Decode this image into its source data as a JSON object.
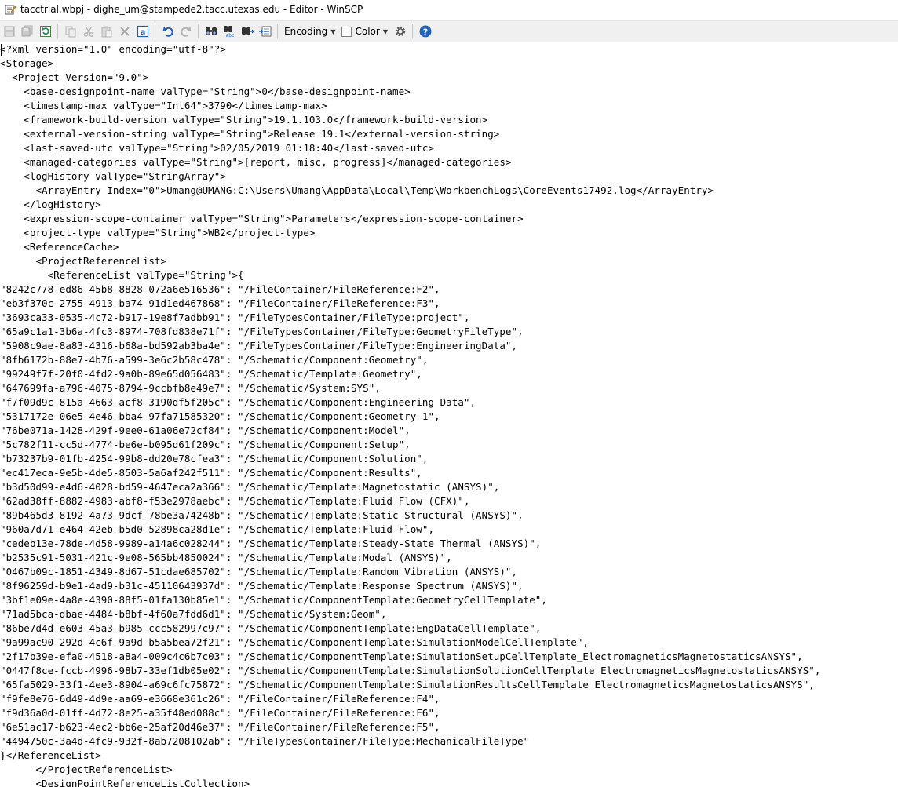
{
  "window": {
    "title": "tacctrial.wbpj - dighe_um@stampede2.tacc.utexas.edu - Editor - WinSCP"
  },
  "toolbar": {
    "buttons": [
      {
        "name": "save-icon",
        "enabled": false
      },
      {
        "name": "save-all-icon",
        "enabled": false
      },
      {
        "name": "reload-icon",
        "enabled": true
      },
      {
        "name": "copy-icon",
        "enabled": false
      },
      {
        "name": "cut-icon",
        "enabled": false
      },
      {
        "name": "paste-icon",
        "enabled": false
      },
      {
        "name": "delete-icon",
        "enabled": false
      },
      {
        "name": "select-all-icon",
        "enabled": true
      },
      {
        "name": "undo-icon",
        "enabled": true
      },
      {
        "name": "redo-icon",
        "enabled": false
      },
      {
        "name": "find-icon",
        "enabled": true
      },
      {
        "name": "replace-icon",
        "enabled": true
      },
      {
        "name": "find-next-icon",
        "enabled": true
      },
      {
        "name": "goto-line-icon",
        "enabled": true
      }
    ],
    "encoding_label": "Encoding",
    "color_label": "Color",
    "settings_icon": "gear-icon",
    "help_icon": "help-icon",
    "colors": {
      "blue": "#1f62b7",
      "green": "#2e8b57",
      "disabled": "#b4b4b4"
    }
  },
  "editor": {
    "lines": [
      "<?xml version=\"1.0\" encoding=\"utf-8\"?>",
      "<Storage>",
      "  <Project Version=\"9.0\">",
      "    <base-designpoint-name valType=\"String\">0</base-designpoint-name>",
      "    <timestamp-max valType=\"Int64\">3790</timestamp-max>",
      "    <framework-build-version valType=\"String\">19.1.103.0</framework-build-version>",
      "    <external-version-string valType=\"String\">Release 19.1</external-version-string>",
      "    <last-saved-utc valType=\"String\">02/05/2019 01:18:40</last-saved-utc>",
      "    <managed-categories valType=\"String\">[report, misc, progress]</managed-categories>",
      "    <logHistory valType=\"StringArray\">",
      "      <ArrayEntry Index=\"0\">Umang@UMANG:C:\\Users\\Umang\\AppData\\Local\\Temp\\WorkbenchLogs\\CoreEvents17492.log</ArrayEntry>",
      "    </logHistory>",
      "    <expression-scope-container valType=\"String\">Parameters</expression-scope-container>",
      "    <project-type valType=\"String\">WB2</project-type>",
      "    <ReferenceCache>",
      "      <ProjectReferenceList>",
      "        <ReferenceList valType=\"String\">{",
      "\"8242c778-ed86-45b8-8828-072a6e516536\": \"/FileContainer/FileReference:F2\",",
      "\"eb3f370c-2755-4913-ba74-91d1ed467868\": \"/FileContainer/FileReference:F3\",",
      "\"3693ca33-0535-4c72-b917-19e8f7adbb91\": \"/FileTypesContainer/FileType:project\",",
      "\"65a9c1a1-3b6a-4fc3-8974-708fd838e71f\": \"/FileTypesContainer/FileType:GeometryFileType\",",
      "\"5908c9ae-8a83-4316-b68a-bd592ab3ba4e\": \"/FileTypesContainer/FileType:EngineeringData\",",
      "\"8fb6172b-88e7-4b76-a599-3e6c2b58c478\": \"/Schematic/Component:Geometry\",",
      "\"99249f7f-20f0-4fd2-9a0b-89e65d056483\": \"/Schematic/Template:Geometry\",",
      "\"647699fa-a796-4075-8794-9ccbfb8e49e7\": \"/Schematic/System:SYS\",",
      "\"f7f09d9c-815a-4663-acf8-3190df5f205c\": \"/Schematic/Component:Engineering Data\",",
      "\"5317172e-06e5-4e46-bba4-97fa71585320\": \"/Schematic/Component:Geometry 1\",",
      "\"76be071a-1428-429f-9ee0-61a06e72cf84\": \"/Schematic/Component:Model\",",
      "\"5c782f11-cc5d-4774-be6e-b095d61f209c\": \"/Schematic/Component:Setup\",",
      "\"b73237b9-01fb-4254-99b8-dd20e78cfea3\": \"/Schematic/Component:Solution\",",
      "\"ec417eca-9e5b-4de5-8503-5a6af242f511\": \"/Schematic/Component:Results\",",
      "\"b3d50d99-e4d6-4028-bd59-4647eca2a366\": \"/Schematic/Template:Magnetostatic (ANSYS)\",",
      "\"62ad38ff-8882-4983-abf8-f53e2978aebc\": \"/Schematic/Template:Fluid Flow (CFX)\",",
      "\"89b465d3-8192-4a73-9dcf-78be3a74248b\": \"/Schematic/Template:Static Structural (ANSYS)\",",
      "\"960a7d71-e464-42eb-b5d0-52898ca28d1e\": \"/Schematic/Template:Fluid Flow\",",
      "\"cedeb13e-78de-4d58-9989-a14a6c028244\": \"/Schematic/Template:Steady-State Thermal (ANSYS)\",",
      "\"b2535c91-5031-421c-9e08-565bb4850024\": \"/Schematic/Template:Modal (ANSYS)\",",
      "\"0467b09c-1851-4349-8d67-51cdae685702\": \"/Schematic/Template:Random Vibration (ANSYS)\",",
      "\"8f96259d-b9e1-4ad9-b31c-45110643937d\": \"/Schematic/Template:Response Spectrum (ANSYS)\",",
      "\"3bf1e09e-4a8e-4390-88f5-01fa130b85e1\": \"/Schematic/ComponentTemplate:GeometryCellTemplate\",",
      "\"71ad5bca-dbae-4484-b8bf-4f60a7fdd6d1\": \"/Schematic/System:Geom\",",
      "\"86be7d4d-e603-45a3-b985-ccc582997c97\": \"/Schematic/ComponentTemplate:EngDataCellTemplate\",",
      "\"9a99ac90-292d-4c6f-9a9d-b5a5bea72f21\": \"/Schematic/ComponentTemplate:SimulationModelCellTemplate\",",
      "\"2f17b39e-efa0-4518-a8a4-009c4c6b7c03\": \"/Schematic/ComponentTemplate:SimulationSetupCellTemplate_ElectromagneticsMagnetostaticsANSYS\",",
      "\"0447f8ce-fccb-4996-98b7-33ef1db05e02\": \"/Schematic/ComponentTemplate:SimulationSolutionCellTemplate_ElectromagneticsMagnetostaticsANSYS\",",
      "\"65fa5029-33f1-4ee3-8904-a69c6fc75872\": \"/Schematic/ComponentTemplate:SimulationResultsCellTemplate_ElectromagneticsMagnetostaticsANSYS\",",
      "\"f9fe8e76-6d49-4d9e-aa69-e3668e361c26\": \"/FileContainer/FileReference:F4\",",
      "\"f9d36a0d-01ff-4d72-8e25-a35f48ed088c\": \"/FileContainer/FileReference:F6\",",
      "\"6e51ac17-b623-4ec2-bb6e-25af20d46e37\": \"/FileContainer/FileReference:F5\",",
      "\"4494750c-3a4d-4fc9-932f-8ab7208102ab\": \"/FileTypesContainer/FileType:MechanicalFileType\"",
      "}</ReferenceList>",
      "      </ProjectReferenceList>",
      "      <DesignPointReferenceListCollection>"
    ]
  }
}
